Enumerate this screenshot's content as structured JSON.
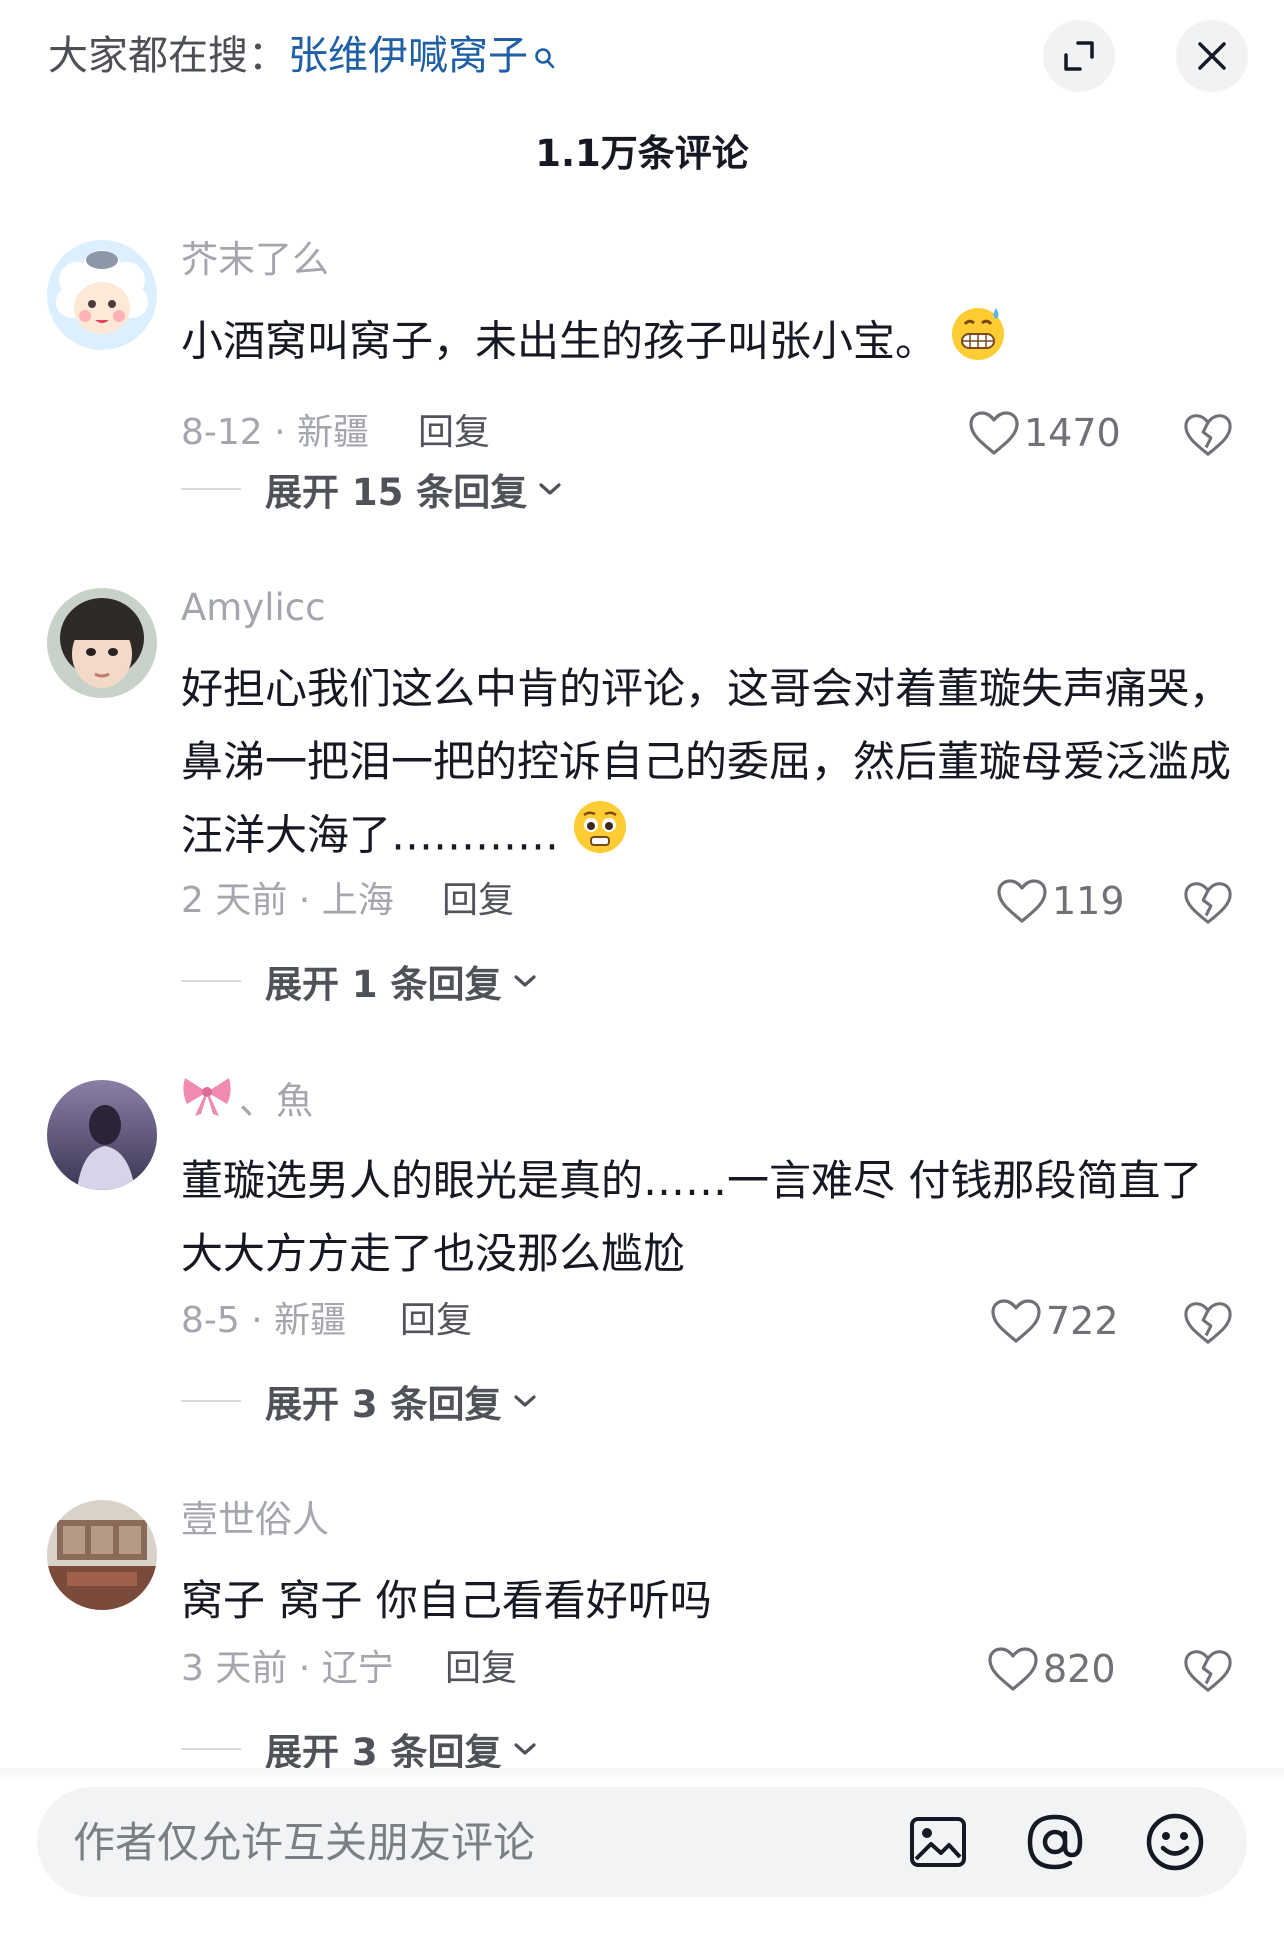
{
  "header": {
    "search_prefix": "大家都在搜：",
    "search_term": "张维伊喊窝子",
    "comment_count": "1.1万条评论"
  },
  "comments": [
    {
      "username": "芥末了么",
      "text": "小酒窝叫窝子，未出生的孩子叫张小宝。",
      "emoji": "grimacing-sweat-emoji",
      "date": "8-12",
      "location": "新疆",
      "reply_label": "回复",
      "likes": "1470",
      "expand_label": "展开 15 条回复"
    },
    {
      "username": "Amylicc",
      "text": "好担心我们这么中肯的评论，这哥会对着董璇失声痛哭，鼻涕一把泪一把的控诉自己的委屈，然后董璇母爱泛滥成汪洋大海了…………",
      "emoji": "pleading-emoji",
      "date": "2 天前",
      "location": "上海",
      "reply_label": "回复",
      "likes": "119",
      "expand_label": "展开 1 条回复"
    },
    {
      "username": "、魚",
      "username_prefix_icon": "ribbon-bow",
      "text": "董璇选男人的眼光是真的……一言难尽 付钱那段简直了 大大方方走了也没那么尴尬",
      "date": "8-5",
      "location": "新疆",
      "reply_label": "回复",
      "likes": "722",
      "expand_label": "展开 3 条回复"
    },
    {
      "username": "壹世俗人",
      "text": "窝子 窝子 你自己看看好听吗",
      "date": "3 天前",
      "location": "辽宁",
      "reply_label": "回复",
      "likes": "820",
      "expand_label": "展开 3 条回复"
    }
  ],
  "input": {
    "placeholder": "作者仅允许互关朋友评论"
  },
  "icons": {
    "expand": "expand-icon",
    "close": "close-icon",
    "like": "heart-outline-icon",
    "dislike": "broken-heart-icon",
    "image": "image-icon",
    "mention": "at-icon",
    "emoji": "smile-icon"
  },
  "colors": {
    "search_term": "#1f5fa6",
    "muted": "#a4a6ad",
    "text": "#161823"
  }
}
